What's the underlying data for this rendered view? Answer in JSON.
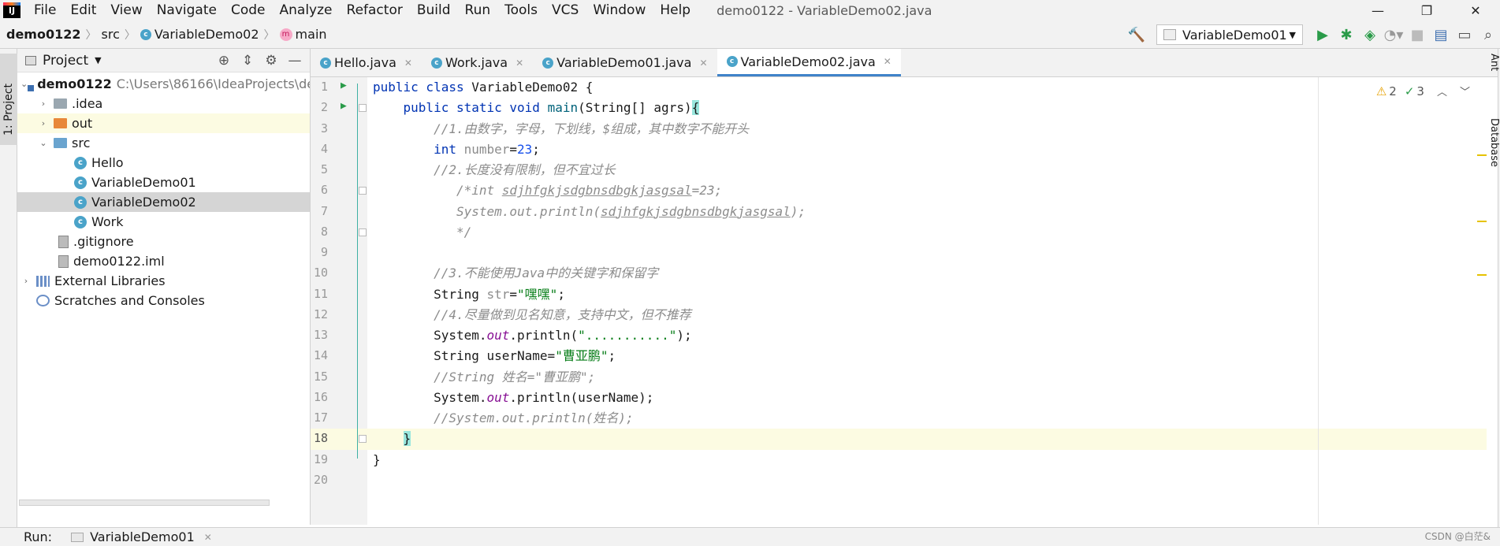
{
  "menu": {
    "items": [
      "File",
      "Edit",
      "View",
      "Navigate",
      "Code",
      "Analyze",
      "Refactor",
      "Build",
      "Run",
      "Tools",
      "VCS",
      "Window",
      "Help"
    ],
    "title": "demo0122 - VariableDemo02.java"
  },
  "window_controls": {
    "minimize": "—",
    "restore": "❐",
    "close": "✕"
  },
  "breadcrumb": {
    "project": "demo0122",
    "folder": "src",
    "class": "VariableDemo02",
    "method": "main"
  },
  "toolbar": {
    "run_config": "VariableDemo01"
  },
  "sidebar": {
    "project_tab": "1: Project"
  },
  "project_panel": {
    "title": "Project",
    "root": {
      "name": "demo0122",
      "path": "C:\\Users\\86166\\IdeaProjects\\de"
    },
    "items": [
      {
        "label": ".idea"
      },
      {
        "label": "out"
      },
      {
        "label": "src"
      },
      {
        "label": "Hello"
      },
      {
        "label": "VariableDemo01"
      },
      {
        "label": "VariableDemo02"
      },
      {
        "label": "Work"
      },
      {
        "label": ".gitignore"
      },
      {
        "label": "demo0122.iml"
      },
      {
        "label": "External Libraries"
      },
      {
        "label": "Scratches and Consoles"
      }
    ]
  },
  "tabs": [
    {
      "label": "Hello.java"
    },
    {
      "label": "Work.java"
    },
    {
      "label": "VariableDemo01.java"
    },
    {
      "label": "VariableDemo02.java"
    }
  ],
  "editor": {
    "line_numbers": [
      "1",
      "2",
      "3",
      "4",
      "5",
      "6",
      "7",
      "8",
      "9",
      "10",
      "11",
      "12",
      "13",
      "14",
      "15",
      "16",
      "17",
      "18",
      "19",
      "20"
    ],
    "current_line": 18,
    "warnings": "2",
    "ok_count": "3"
  },
  "right_stripe": {
    "ant": "Ant",
    "database": "Database"
  },
  "bottom": {
    "run_label": "Run:",
    "run_tab": "VariableDemo01",
    "watermark": "CSDN @白茫&"
  },
  "colors": {
    "accent": "#4083c9",
    "keyword": "#0033b3",
    "string": "#067d17",
    "comment": "#8c8c8c"
  }
}
